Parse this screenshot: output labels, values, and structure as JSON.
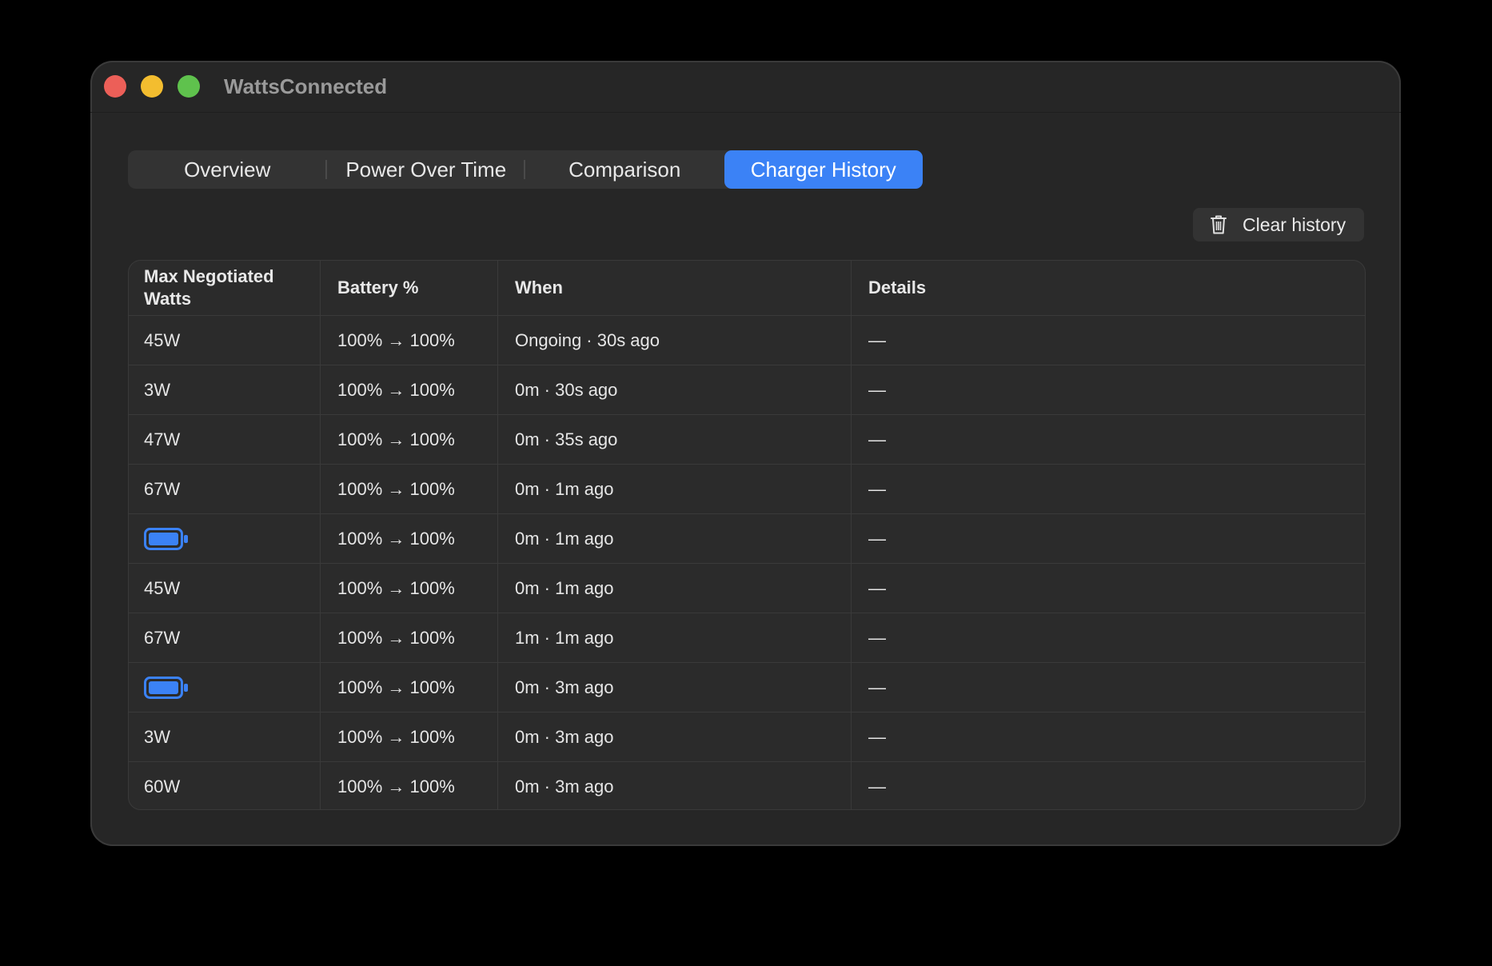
{
  "window": {
    "title": "WattsConnected"
  },
  "tabs": [
    {
      "label": "Overview",
      "active": false
    },
    {
      "label": "Power Over Time",
      "active": false
    },
    {
      "label": "Comparison",
      "active": false
    },
    {
      "label": "Charger History",
      "active": true
    }
  ],
  "toolbar": {
    "clear_label": "Clear history",
    "clear_icon": "trash-icon"
  },
  "table": {
    "headers": [
      "Max Negotiated Watts",
      "Battery %",
      "When",
      "Details"
    ],
    "rows": [
      {
        "watts": "45W",
        "battery": "100% → 100%",
        "when": "Ongoing · 30s ago",
        "details": "—"
      },
      {
        "watts": "3W",
        "battery": "100% → 100%",
        "when": "0m · 30s ago",
        "details": "—"
      },
      {
        "watts": "47W",
        "battery": "100% → 100%",
        "when": "0m · 35s ago",
        "details": "—"
      },
      {
        "watts": "67W",
        "battery": "100% → 100%",
        "when": "0m · 1m ago",
        "details": "—"
      },
      {
        "watts": "",
        "icon": "battery-full-icon",
        "battery": "100% → 100%",
        "when": "0m · 1m ago",
        "details": "—"
      },
      {
        "watts": "45W",
        "battery": "100% → 100%",
        "when": "0m · 1m ago",
        "details": "—"
      },
      {
        "watts": "67W",
        "battery": "100% → 100%",
        "when": "1m · 1m ago",
        "details": "—"
      },
      {
        "watts": "",
        "icon": "battery-full-icon",
        "battery": "100% → 100%",
        "when": "0m · 3m ago",
        "details": "—"
      },
      {
        "watts": "3W",
        "battery": "100% → 100%",
        "when": "0m · 3m ago",
        "details": "—"
      },
      {
        "watts": "60W",
        "battery": "100% → 100%",
        "when": "0m · 3m ago",
        "details": "—"
      }
    ]
  },
  "colors": {
    "accent": "#3b82f6",
    "window_bg": "#262626",
    "close": "#ec5f58",
    "minimize": "#f3bd2f",
    "zoom": "#5fc24d"
  }
}
